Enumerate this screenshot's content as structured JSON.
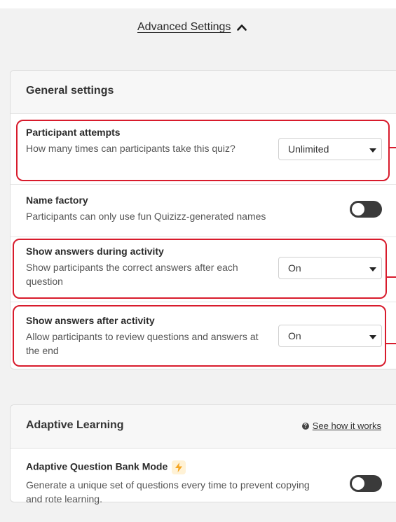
{
  "advanced": {
    "label": "Advanced Settings"
  },
  "general": {
    "title": "General settings",
    "rows": [
      {
        "title": "Participant attempts",
        "desc": "How many times can participants take this quiz?",
        "control": "select",
        "value": "Unlimited"
      },
      {
        "title": "Name factory",
        "desc": "Participants can only use fun Quizizz-generated names",
        "control": "toggle",
        "on": false
      },
      {
        "title": "Show answers during activity",
        "desc": "Show participants the correct answers after each question",
        "control": "select",
        "value": "On"
      },
      {
        "title": "Show answers after activity",
        "desc": "Allow participants to review questions and answers at the end",
        "control": "select",
        "value": "On"
      }
    ]
  },
  "adaptive": {
    "title": "Adaptive Learning",
    "link": "See how it works",
    "link_icon": "help-icon",
    "row": {
      "title": "Adaptive Question Bank Mode",
      "badge_icon": "lightning-icon",
      "desc": "Generate a unique set of questions every time to prevent copying and rote learning.",
      "control": "toggle",
      "on": false
    }
  },
  "colors": {
    "highlight": "#d81b2c",
    "toggle_off": "#3a3a3a",
    "badge_bg": "#fff2d6",
    "badge_bolt": "#f5a623"
  }
}
